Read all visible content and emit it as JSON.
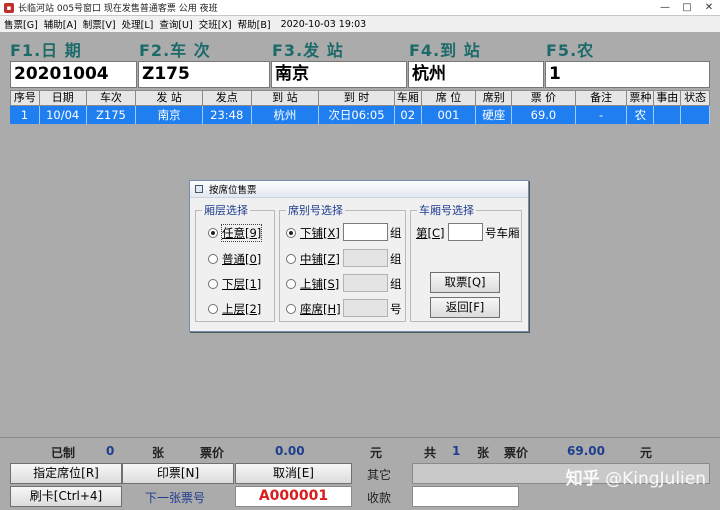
{
  "window": {
    "title": "长临河站 005号窗口 现在发售普通客票 公用 夜班",
    "buttons": [
      "—",
      "□",
      "✕"
    ]
  },
  "menu": {
    "items": [
      "售票[G]",
      "辅助[A]",
      "制票[V]",
      "处理[L]",
      "查询[U]",
      "交班[X]",
      "帮助[B]"
    ],
    "datetime": "2020-10-03 19:03"
  },
  "fkeys": [
    {
      "label": "F1.日 期",
      "value": "20201004"
    },
    {
      "label": "F2.车 次",
      "value": "Z175"
    },
    {
      "label": "F3.发 站",
      "value": "南京"
    },
    {
      "label": "F4.到 站",
      "value": "杭州"
    },
    {
      "label": "F5.农",
      "value": "1"
    }
  ],
  "table": {
    "headers": [
      "序号",
      "日期",
      "车次",
      "发 站",
      "发点",
      "到 站",
      "到 时",
      "车厢",
      "席 位",
      "席别",
      "票 价",
      "备注",
      "票种",
      "事由",
      "状态"
    ],
    "rows": [
      [
        "1",
        "10/04",
        "Z175",
        "南京",
        "23:48",
        "杭州",
        "次日06:05",
        "02",
        "001",
        "硬座",
        "69.0",
        "-",
        "农",
        "",
        ""
      ]
    ]
  },
  "dialog": {
    "title": "按席位售票",
    "group_floor": {
      "label": "厢层选择",
      "options": [
        "任意[9]",
        "普通[0]",
        "下层[1]",
        "上层[2]"
      ],
      "selected_index": 0
    },
    "group_berth": {
      "label": "席别号选择",
      "options": [
        "下铺[X]",
        "中铺[Z]",
        "上铺[S]",
        "座席[H]"
      ],
      "units": [
        "组",
        "组",
        "组",
        "号"
      ],
      "selected_index": 0
    },
    "group_car": {
      "label": "车厢号选择",
      "prefix": "第[C]",
      "suffix": "号车厢",
      "take_button": "取票[Q]",
      "back_button": "返回[F]"
    }
  },
  "summary": {
    "made_label": "已制",
    "made_count": "0",
    "zhang1": "张",
    "price_label1": "票价",
    "price1": "0.00",
    "yuan1": "元",
    "total_label": "共",
    "total_count": "1",
    "zhang2": "张",
    "price_label2": "票价",
    "price2": "69.00",
    "yuan2": "元"
  },
  "bottom": {
    "btn_assign_seat": "指定席位[R]",
    "btn_print": "印票[N]",
    "btn_cancel": "取消[E]",
    "btn_card": "刷卡[Ctrl+4]",
    "next_ticket_label": "下一张票号",
    "next_ticket_value": "A000001",
    "other_label": "其它",
    "receive_label": "收款"
  },
  "watermark": {
    "brand": "知乎",
    "handle": "@KingJulien"
  },
  "colors": {
    "row_selected": "#1f7ef0",
    "fkey_label": "#1d6a6a",
    "next_ticket": "#d81e1e",
    "group_label": "#1e3d8f"
  }
}
